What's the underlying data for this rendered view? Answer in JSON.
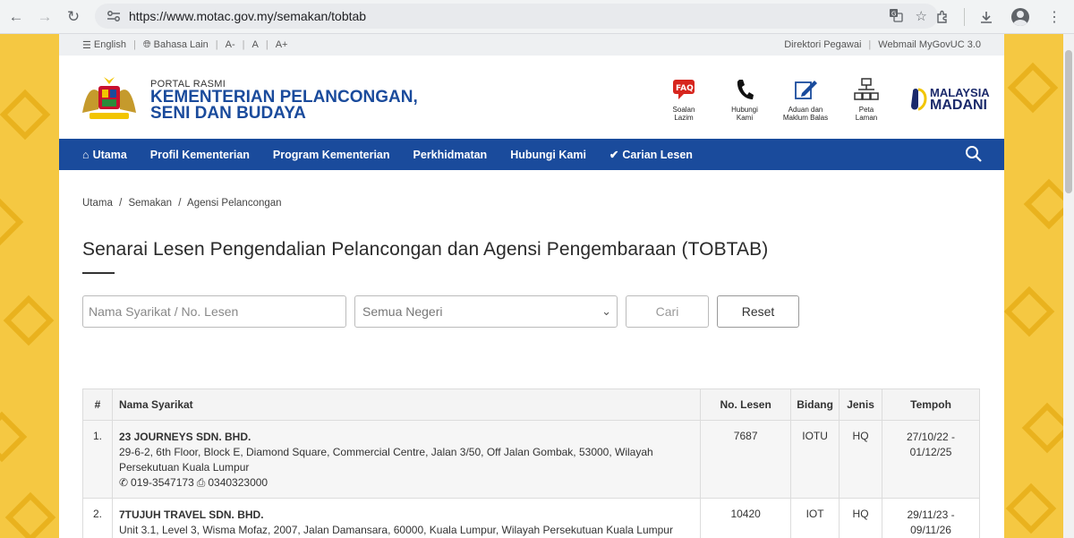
{
  "browser": {
    "url": "https://www.motac.gov.my/semakan/tobtab"
  },
  "topbar": {
    "english": "English",
    "bahasa": "Bahasa Lain",
    "font_small": "A-",
    "font_normal": "A",
    "font_large": "A+",
    "direktori": "Direktori Pegawai",
    "webmail": "Webmail MyGovUC 3.0"
  },
  "header": {
    "portal_label": "PORTAL RASMI",
    "ministry_line1": "KEMENTERIAN PELANCONGAN,",
    "ministry_line2": "SENI DAN BUDAYA",
    "quick_links": [
      {
        "icon": "faq-icon",
        "label1": "Soalan",
        "label2": "Lazim"
      },
      {
        "icon": "phone-icon",
        "label1": "Hubungi",
        "label2": "Kami"
      },
      {
        "icon": "feedback-icon",
        "label1": "Aduan dan",
        "label2": "Maklum Balas"
      },
      {
        "icon": "sitemap-icon",
        "label1": "Peta",
        "label2": "Laman"
      }
    ],
    "madani_line1": "MALAYSIA",
    "madani_line2": "MADANI"
  },
  "nav": {
    "items": [
      "Utama",
      "Profil Kementerian",
      "Program Kementerian",
      "Perkhidmatan",
      "Hubungi Kami",
      "Carian Lesen"
    ]
  },
  "breadcrumb": [
    "Utama",
    "/",
    "Semakan",
    "/",
    "Agensi Pelancongan"
  ],
  "page": {
    "title": "Senarai Lesen Pengendalian Pelancongan dan Agensi Pengembaraan (TOBTAB)"
  },
  "filters": {
    "search_placeholder": "Nama Syarikat / No. Lesen",
    "state_selected": "Semua Negeri",
    "cari": "Cari",
    "reset": "Reset"
  },
  "table": {
    "headers": [
      "#",
      "Nama Syarikat",
      "No. Lesen",
      "Bidang",
      "Jenis",
      "Tempoh"
    ],
    "rows": [
      {
        "no": "1.",
        "name": "23 JOURNEYS SDN. BHD.",
        "address": "29-6-2, 6th Floor, Block E, Diamond Square, Commercial Centre, Jalan 3/50, Off Jalan Gombak, 53000, Wilayah Persekutuan Kuala Lumpur",
        "phone": "019-3547173",
        "fax": "0340323000",
        "license": "7687",
        "bidang": "IOTU",
        "jenis": "HQ",
        "tempoh1": "27/10/22 -",
        "tempoh2": "01/12/25"
      },
      {
        "no": "2.",
        "name": "7TUJUH TRAVEL SDN. BHD.",
        "address": "Unit 3.1, Level 3, Wisma Mofaz, 2007, Jalan Damansara, 60000, Kuala Lumpur, Wilayah Persekutuan Kuala Lumpur",
        "license": "10420",
        "bidang": "IOT",
        "jenis": "HQ",
        "tempoh1": "29/11/23 -",
        "tempoh2": "09/11/26"
      }
    ]
  }
}
